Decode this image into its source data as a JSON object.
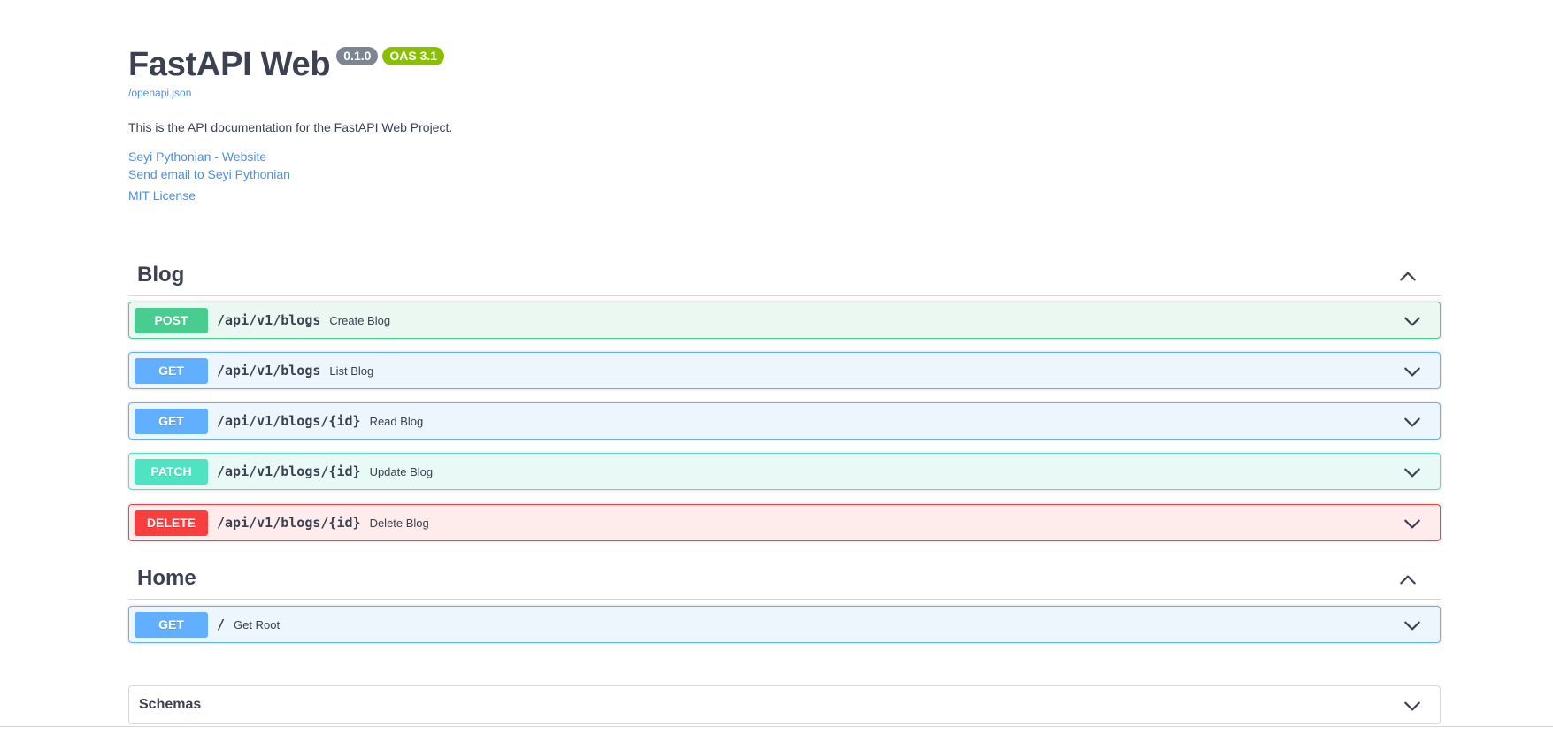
{
  "info": {
    "title": "FastAPI Web",
    "version": "0.1.0",
    "oas": "OAS 3.1",
    "openapi_link": "/openapi.json",
    "description": "This is the API documentation for the FastAPI Web Project.",
    "website_link": "Seyi Pythonian - Website",
    "email_link": "Send email to Seyi Pythonian",
    "license_link": "MIT License"
  },
  "tags": [
    {
      "name": "Blog",
      "operations": [
        {
          "method": "POST",
          "path": "/api/v1/blogs",
          "summary": "Create Blog"
        },
        {
          "method": "GET",
          "path": "/api/v1/blogs",
          "summary": "List Blog"
        },
        {
          "method": "GET",
          "path": "/api/v1/blogs/{id}",
          "summary": "Read Blog"
        },
        {
          "method": "PATCH",
          "path": "/api/v1/blogs/{id}",
          "summary": "Update Blog"
        },
        {
          "method": "DELETE",
          "path": "/api/v1/blogs/{id}",
          "summary": "Delete Blog"
        }
      ]
    },
    {
      "name": "Home",
      "operations": [
        {
          "method": "GET",
          "path": "/",
          "summary": "Get Root"
        }
      ]
    }
  ],
  "schemas": {
    "title": "Schemas"
  },
  "colors": {
    "post": "#49cc90",
    "get": "#61affe",
    "patch": "#50e3c2",
    "delete": "#f93e3e",
    "link": "#4990e2"
  },
  "icons": {
    "expand": "chevron-down-icon",
    "collapse": "chevron-up-icon"
  }
}
